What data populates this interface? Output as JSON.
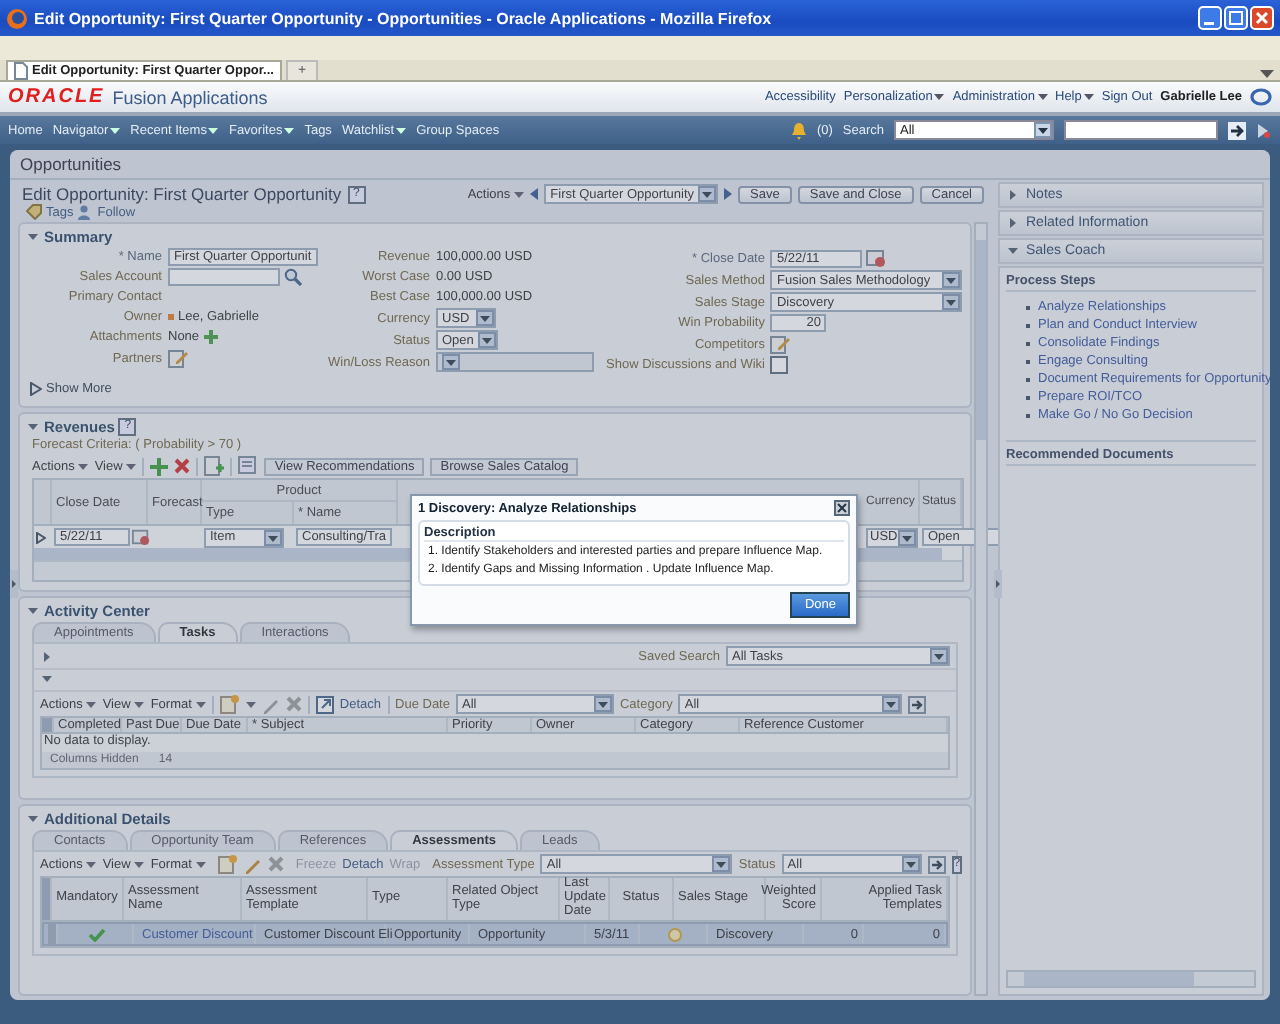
{
  "window": {
    "title": "Edit Opportunity: First Quarter Opportunity - Opportunities - Oracle Applications - Mozilla Firefox"
  },
  "browser_tabs": [
    {
      "label": "Edit Opportunity: First Quarter Oppor...",
      "selected": true
    }
  ],
  "new_tab": "+",
  "app_header": {
    "logo": "ORACLE",
    "product": "Fusion Applications",
    "user": "Gabrielle Lee",
    "links": [
      {
        "label": "Accessibility",
        "menu": false
      },
      {
        "label": "Personalization",
        "menu": true
      },
      {
        "label": "Administration",
        "menu": true
      },
      {
        "label": "Help",
        "menu": true
      },
      {
        "label": "Sign Out",
        "menu": false
      }
    ]
  },
  "nav": {
    "notifications": "(0)",
    "search_label": "Search",
    "search_scope": "All",
    "items": [
      {
        "label": "Home",
        "menu": false
      },
      {
        "label": "Navigator",
        "menu": true
      },
      {
        "label": "Recent Items",
        "menu": true
      },
      {
        "label": "Favorites",
        "menu": true
      },
      {
        "label": "Tags",
        "menu": false
      },
      {
        "label": "Watchlist",
        "menu": true
      },
      {
        "label": "Group Spaces",
        "menu": false
      }
    ]
  },
  "page_title": "Opportunities",
  "edit": {
    "title": "Edit Opportunity: First Quarter Opportunity",
    "help": "?",
    "actions": "Actions",
    "record": "First Quarter Opportunity",
    "tags": "Tags",
    "follow": "Follow",
    "buttons": [
      "Save",
      "Save and Close",
      "Cancel"
    ]
  },
  "summary": {
    "title": "Summary",
    "expanded": true,
    "show_more": "Show More",
    "columns": [
      {
        "fields": [
          {
            "label": "* Name",
            "required": true,
            "kind": "input",
            "value": "First Quarter Opportunit"
          },
          {
            "label": "Sales Account",
            "required": false,
            "kind": "lookup"
          },
          {
            "label": "Primary Contact",
            "required": false,
            "kind": "label"
          },
          {
            "label": "Owner",
            "required": false,
            "kind": "owner",
            "value": "Lee, Gabrielle"
          },
          {
            "label": "Attachments",
            "required": false,
            "kind": "attach",
            "value": "None"
          },
          {
            "label": "Partners",
            "required": false,
            "kind": "edit"
          }
        ]
      },
      {
        "fields": [
          {
            "label": "Revenue",
            "required": false,
            "kind": "text",
            "value": "100,000.00  USD"
          },
          {
            "label": "Worst Case",
            "required": false,
            "kind": "text",
            "value": "0.00  USD"
          },
          {
            "label": "Best Case",
            "required": false,
            "kind": "text",
            "value": "100,000.00  USD"
          },
          {
            "label": "Currency",
            "required": false,
            "kind": "select",
            "value": "USD",
            "disabled": false
          },
          {
            "label": "Status",
            "required": false,
            "kind": "select",
            "value": "Open",
            "disabled": false
          },
          {
            "label": "Win/Loss Reason",
            "required": false,
            "kind": "select",
            "disabled": true
          }
        ]
      },
      {
        "fields": [
          {
            "label": "* Close Date",
            "required": true,
            "kind": "date",
            "value": "5/22/11"
          },
          {
            "label": "Sales Method",
            "required": false,
            "kind": "select",
            "value": "Fusion Sales Methodology",
            "disabled": false
          },
          {
            "label": "Sales Stage",
            "required": false,
            "kind": "select",
            "value": "Discovery",
            "disabled": false
          },
          {
            "label": "Win Probability",
            "required": false,
            "kind": "number",
            "value": "20"
          },
          {
            "label": "Competitors",
            "required": false,
            "kind": "edit"
          },
          {
            "label": "Show Discussions and Wiki",
            "required": false,
            "kind": "checkbox",
            "checked": false
          }
        ]
      }
    ]
  },
  "revenues": {
    "title": "Revenues",
    "help": "?",
    "criteria": "Forecast Criteria: ( Probability > 70 )",
    "menus": [
      "Actions",
      "View"
    ],
    "buttons": [
      "View Recommendations",
      "Browse Sales Catalog"
    ],
    "group_header": "Product",
    "columns": [
      "Close Date",
      "Forecast",
      "Type",
      "* Name",
      "Currency",
      "Status"
    ],
    "rows": [
      {
        "close_date": "5/22/11",
        "type": "Item",
        "name": "Consulting/Tra",
        "currency": "USD",
        "status": "Open"
      }
    ]
  },
  "dialog": {
    "title": "1 Discovery: Analyze Relationships",
    "heading": "Description",
    "steps": [
      "1. Identify Stakeholders and interested parties and prepare Influence Map.",
      "2. Identify Gaps and Missing Information . Update Influence Map."
    ],
    "button": "Done"
  },
  "activity": {
    "title": "Activity Center",
    "tabs": [
      {
        "label": "Appointments",
        "selected": false
      },
      {
        "label": "Tasks",
        "selected": true
      },
      {
        "label": "Interactions",
        "selected": false
      }
    ],
    "saved_search_label": "Saved Search",
    "saved_search": "All Tasks",
    "menus": [
      "Actions",
      "View",
      "Format"
    ],
    "detach": "Detach",
    "filters": [
      {
        "label": "Due Date",
        "value": "All"
      },
      {
        "label": "Category",
        "value": "All"
      }
    ],
    "columns": [
      "Completed",
      "Past Due",
      "Due Date",
      "* Subject",
      "Priority",
      "Owner",
      "Category",
      "Reference Customer"
    ],
    "empty": "No data to display.",
    "hidden_label": "Columns Hidden",
    "hidden_count": "14"
  },
  "additional": {
    "title": "Additional Details",
    "tabs": [
      {
        "label": "Contacts",
        "selected": false
      },
      {
        "label": "Opportunity Team",
        "selected": false
      },
      {
        "label": "References",
        "selected": false
      },
      {
        "label": "Assessments",
        "selected": true
      },
      {
        "label": "Leads",
        "selected": false
      }
    ],
    "menus": [
      "Actions",
      "View",
      "Format"
    ],
    "actions": [
      {
        "label": "Freeze",
        "disabled": true
      },
      {
        "label": "Detach",
        "disabled": false
      },
      {
        "label": "Wrap",
        "disabled": true
      }
    ],
    "filters": [
      {
        "label": "Assessment Type",
        "value": "All"
      },
      {
        "label": "Status",
        "value": "All"
      }
    ],
    "help": "?",
    "columns": [
      "Mandatory",
      "Assessment Name",
      "Assessment Template",
      "Type",
      "Related Object Type",
      "Last Update Date",
      "Status",
      "Sales Stage",
      "Weighted Score",
      "Applied Task Templates"
    ],
    "rows": [
      {
        "selected": true,
        "mandatory": true,
        "name": "Customer Discount",
        "template": "Customer Discount Eli",
        "type": "Opportunity",
        "object_type": "Opportunity",
        "updated": "5/3/11",
        "sales_stage": "Discovery",
        "score": "0",
        "templates": "0"
      }
    ]
  },
  "side": {
    "panels": [
      {
        "title": "Notes",
        "expanded": false
      },
      {
        "title": "Related Information",
        "expanded": false
      },
      {
        "title": "Sales Coach",
        "expanded": true
      }
    ],
    "steps_title": "Process Steps",
    "steps": [
      "Analyze Relationships",
      "Plan and Conduct Interview",
      "Consolidate Findings",
      "Engage Consulting",
      "Document Requirements for Opportunity",
      "Prepare ROI/TCO",
      "Make Go / No Go Decision"
    ],
    "docs_title": "Recommended Documents"
  }
}
